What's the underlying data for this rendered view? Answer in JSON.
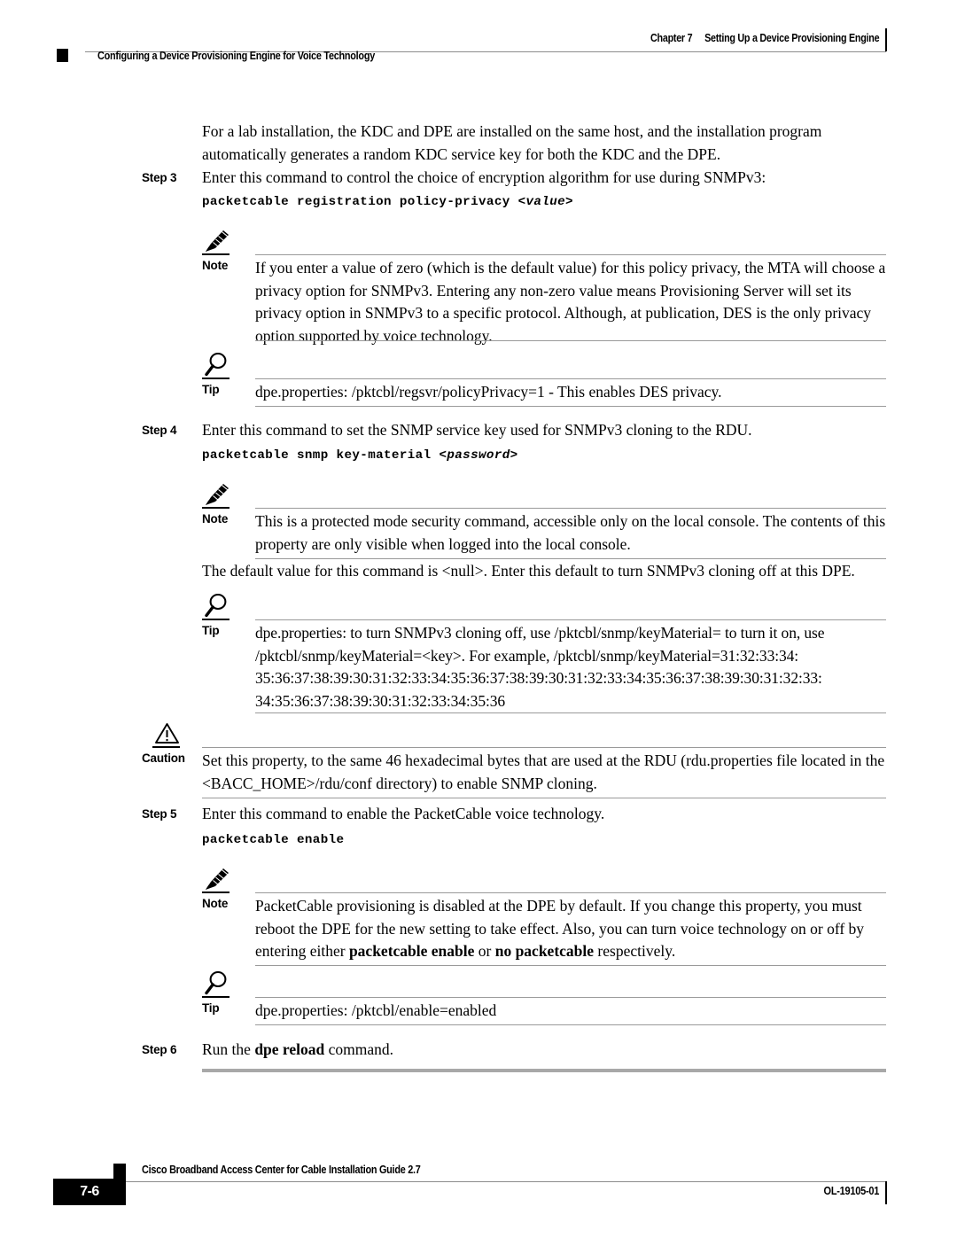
{
  "header": {
    "chapter_number": "Chapter 7",
    "chapter_title": "Setting Up a Device Provisioning Engine",
    "section_title": "Configuring a Device Provisioning Engine for Voice Technology"
  },
  "body": {
    "intro_paragraph": "For a lab installation, the KDC and DPE are installed on the same host, and the installation program automatically generates a random KDC service key for both the KDC and the DPE.",
    "step3": {
      "label": "Step 3",
      "text": "Enter this command to control the choice of encryption algorithm for use during SNMPv3:",
      "command_name": "packetcable registration policy-privacy",
      "command_arg": "<value>"
    },
    "note1": {
      "label": "Note",
      "icon": "pencil-icon",
      "text": "If you enter a value of zero (which is the default value) for this policy privacy, the MTA will choose a privacy option for SNMPv3. Entering any non-zero value means Provisioning Server will set its privacy option in SNMPv3 to a specific protocol. Although, at publication, DES is the only privacy option supported by voice technology."
    },
    "tip1": {
      "label": "Tip",
      "icon": "magnifier-icon",
      "text": "dpe.properties: /pktcbl/regsvr/policyPrivacy=1 - This enables DES privacy."
    },
    "step4": {
      "label": "Step 4",
      "text": "Enter this command to set the SNMP service key used for SNMPv3 cloning to the RDU.",
      "command_name": "packetcable snmp key-material",
      "command_arg": "<password>"
    },
    "note2": {
      "label": "Note",
      "icon": "pencil-icon",
      "text": "This is a protected mode security command, accessible only on the local console. The contents of this property are only visible when logged into the local console."
    },
    "default_paragraph": "The default value for this command is <null>. Enter this default to turn SNMPv3 cloning off at this DPE.",
    "tip2": {
      "label": "Tip",
      "icon": "magnifier-icon",
      "line1": "dpe.properties: to turn SNMPv3 cloning off, use /pktcbl/snmp/keyMaterial= to turn it on, use",
      "line2": "/pktcbl/snmp/keyMaterial=<key>. For example, /pktcbl/snmp/keyMaterial=31:32:33:34:",
      "line3": "35:36:37:38:39:30:31:32:33:34:35:36:37:38:39:30:31:32:33:34:35:36:37:38:39:30:31:32:33:",
      "line4": "34:35:36:37:38:39:30:31:32:33:34:35:36"
    },
    "caution": {
      "label": "Caution",
      "icon": "warning-triangle-icon",
      "text": "Set this property, to the same 46 hexadecimal bytes that are used at the RDU (rdu.properties file located in the <BACC_HOME>/rdu/conf directory) to enable SNMP cloning."
    },
    "step5": {
      "label": "Step 5",
      "text": "Enter this command to enable the PacketCable voice technology.",
      "command_name": "packetcable enable"
    },
    "note3": {
      "label": "Note",
      "icon": "pencil-icon",
      "text_part1": "PacketCable provisioning is disabled at the DPE by default. If you change this property, you must reboot the DPE for the new setting to take effect. Also, you can turn voice technology on or off by entering either ",
      "bold1": "packetcable enable",
      "text_part2": " or ",
      "bold2": "no packetcable",
      "text_part3": " respectively."
    },
    "tip3": {
      "label": "Tip",
      "icon": "magnifier-icon",
      "text": "dpe.properties: /pktcbl/enable=enabled"
    },
    "step6": {
      "label": "Step 6",
      "text_part1": "Run the ",
      "bold1": "dpe reload",
      "text_part2": " command."
    }
  },
  "footer": {
    "guide_title": "Cisco Broadband Access Center for Cable Installation Guide 2.7",
    "page_number": "7-6",
    "doc_id": "OL-19105-01"
  }
}
